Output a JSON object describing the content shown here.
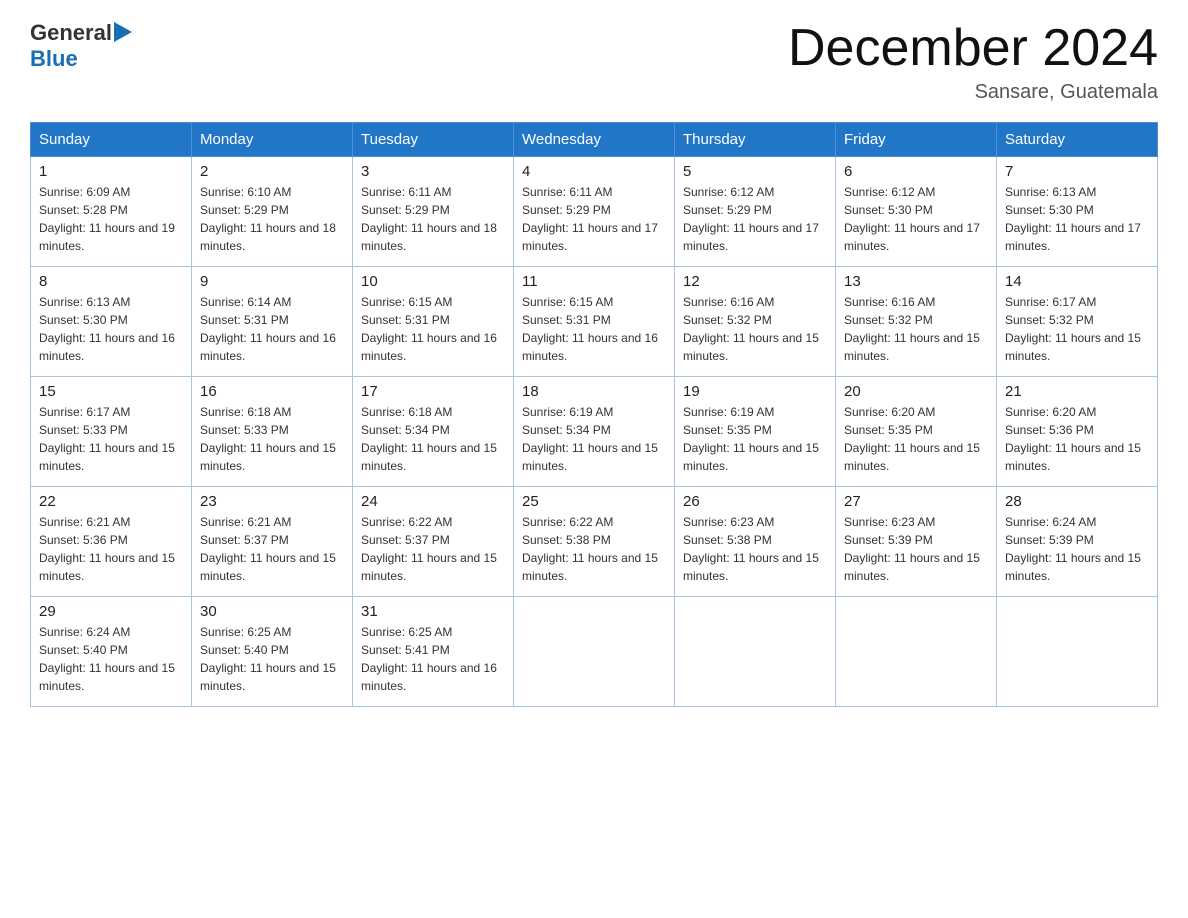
{
  "header": {
    "logo_general": "General",
    "logo_blue": "Blue",
    "month_title": "December 2024",
    "subtitle": "Sansare, Guatemala"
  },
  "weekdays": [
    "Sunday",
    "Monday",
    "Tuesday",
    "Wednesday",
    "Thursday",
    "Friday",
    "Saturday"
  ],
  "weeks": [
    [
      {
        "day": "1",
        "sunrise": "6:09 AM",
        "sunset": "5:28 PM",
        "daylight": "11 hours and 19 minutes."
      },
      {
        "day": "2",
        "sunrise": "6:10 AM",
        "sunset": "5:29 PM",
        "daylight": "11 hours and 18 minutes."
      },
      {
        "day": "3",
        "sunrise": "6:11 AM",
        "sunset": "5:29 PM",
        "daylight": "11 hours and 18 minutes."
      },
      {
        "day": "4",
        "sunrise": "6:11 AM",
        "sunset": "5:29 PM",
        "daylight": "11 hours and 17 minutes."
      },
      {
        "day": "5",
        "sunrise": "6:12 AM",
        "sunset": "5:29 PM",
        "daylight": "11 hours and 17 minutes."
      },
      {
        "day": "6",
        "sunrise": "6:12 AM",
        "sunset": "5:30 PM",
        "daylight": "11 hours and 17 minutes."
      },
      {
        "day": "7",
        "sunrise": "6:13 AM",
        "sunset": "5:30 PM",
        "daylight": "11 hours and 17 minutes."
      }
    ],
    [
      {
        "day": "8",
        "sunrise": "6:13 AM",
        "sunset": "5:30 PM",
        "daylight": "11 hours and 16 minutes."
      },
      {
        "day": "9",
        "sunrise": "6:14 AM",
        "sunset": "5:31 PM",
        "daylight": "11 hours and 16 minutes."
      },
      {
        "day": "10",
        "sunrise": "6:15 AM",
        "sunset": "5:31 PM",
        "daylight": "11 hours and 16 minutes."
      },
      {
        "day": "11",
        "sunrise": "6:15 AM",
        "sunset": "5:31 PM",
        "daylight": "11 hours and 16 minutes."
      },
      {
        "day": "12",
        "sunrise": "6:16 AM",
        "sunset": "5:32 PM",
        "daylight": "11 hours and 15 minutes."
      },
      {
        "day": "13",
        "sunrise": "6:16 AM",
        "sunset": "5:32 PM",
        "daylight": "11 hours and 15 minutes."
      },
      {
        "day": "14",
        "sunrise": "6:17 AM",
        "sunset": "5:32 PM",
        "daylight": "11 hours and 15 minutes."
      }
    ],
    [
      {
        "day": "15",
        "sunrise": "6:17 AM",
        "sunset": "5:33 PM",
        "daylight": "11 hours and 15 minutes."
      },
      {
        "day": "16",
        "sunrise": "6:18 AM",
        "sunset": "5:33 PM",
        "daylight": "11 hours and 15 minutes."
      },
      {
        "day": "17",
        "sunrise": "6:18 AM",
        "sunset": "5:34 PM",
        "daylight": "11 hours and 15 minutes."
      },
      {
        "day": "18",
        "sunrise": "6:19 AM",
        "sunset": "5:34 PM",
        "daylight": "11 hours and 15 minutes."
      },
      {
        "day": "19",
        "sunrise": "6:19 AM",
        "sunset": "5:35 PM",
        "daylight": "11 hours and 15 minutes."
      },
      {
        "day": "20",
        "sunrise": "6:20 AM",
        "sunset": "5:35 PM",
        "daylight": "11 hours and 15 minutes."
      },
      {
        "day": "21",
        "sunrise": "6:20 AM",
        "sunset": "5:36 PM",
        "daylight": "11 hours and 15 minutes."
      }
    ],
    [
      {
        "day": "22",
        "sunrise": "6:21 AM",
        "sunset": "5:36 PM",
        "daylight": "11 hours and 15 minutes."
      },
      {
        "day": "23",
        "sunrise": "6:21 AM",
        "sunset": "5:37 PM",
        "daylight": "11 hours and 15 minutes."
      },
      {
        "day": "24",
        "sunrise": "6:22 AM",
        "sunset": "5:37 PM",
        "daylight": "11 hours and 15 minutes."
      },
      {
        "day": "25",
        "sunrise": "6:22 AM",
        "sunset": "5:38 PM",
        "daylight": "11 hours and 15 minutes."
      },
      {
        "day": "26",
        "sunrise": "6:23 AM",
        "sunset": "5:38 PM",
        "daylight": "11 hours and 15 minutes."
      },
      {
        "day": "27",
        "sunrise": "6:23 AM",
        "sunset": "5:39 PM",
        "daylight": "11 hours and 15 minutes."
      },
      {
        "day": "28",
        "sunrise": "6:24 AM",
        "sunset": "5:39 PM",
        "daylight": "11 hours and 15 minutes."
      }
    ],
    [
      {
        "day": "29",
        "sunrise": "6:24 AM",
        "sunset": "5:40 PM",
        "daylight": "11 hours and 15 minutes."
      },
      {
        "day": "30",
        "sunrise": "6:25 AM",
        "sunset": "5:40 PM",
        "daylight": "11 hours and 15 minutes."
      },
      {
        "day": "31",
        "sunrise": "6:25 AM",
        "sunset": "5:41 PM",
        "daylight": "11 hours and 16 minutes."
      },
      null,
      null,
      null,
      null
    ]
  ]
}
